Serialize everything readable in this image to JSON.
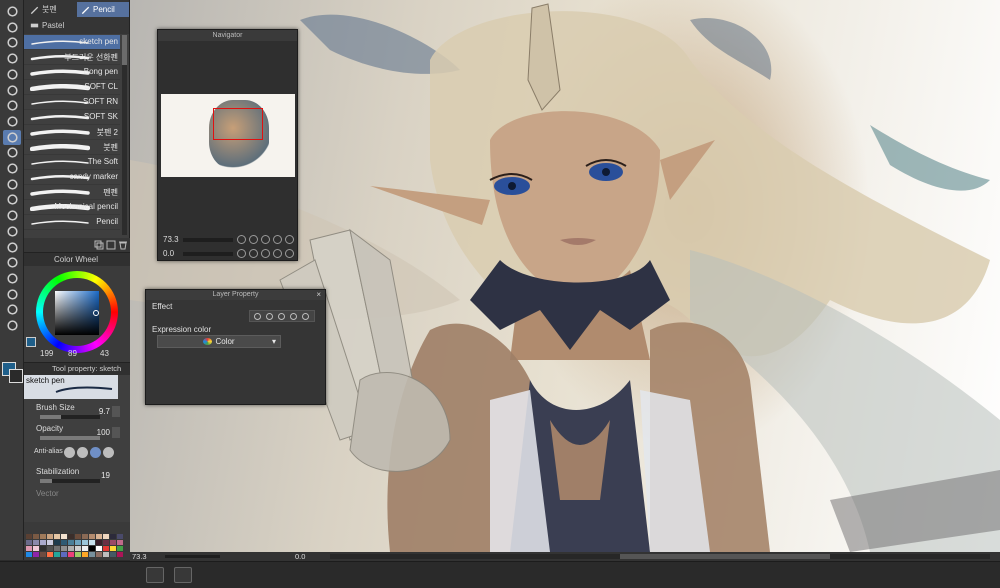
{
  "tools": {
    "items": [
      "hand-icon",
      "zoom-icon",
      "move-icon",
      "lasso-icon",
      "magic-wand-icon",
      "eyedropper-icon",
      "pen-icon",
      "pencil-icon",
      "brush-icon",
      "airbrush-icon",
      "decoration-icon",
      "eraser-icon",
      "blend-icon",
      "fill-icon",
      "gradient-icon",
      "figure-icon",
      "frame-icon",
      "ruler-icon",
      "text-icon",
      "balloon-icon",
      "correct-line-icon"
    ],
    "active_index": 8,
    "colors": {
      "main": "#1f5f8a",
      "sub": "#2a2a2a"
    }
  },
  "brush_panel": {
    "tabs": [
      {
        "label": "붓펜",
        "active": false
      },
      {
        "label": "Pencil",
        "active": true
      },
      {
        "label": "Pastel",
        "active": false
      }
    ],
    "brushes": [
      {
        "name": "sketch pen",
        "active": true
      },
      {
        "name": "부드러운 선화펜",
        "active": false
      },
      {
        "name": "Bong pen",
        "active": false
      },
      {
        "name": "SOFT CL",
        "active": false
      },
      {
        "name": "SOFT RN",
        "active": false
      },
      {
        "name": "SOFT SK",
        "active": false
      },
      {
        "name": "붓펜 2",
        "active": false
      },
      {
        "name": "붓펜",
        "active": false
      },
      {
        "name": "The Soft",
        "active": false
      },
      {
        "name": "candy marker",
        "active": false
      },
      {
        "name": "펜펜",
        "active": false
      },
      {
        "name": "Mechanical pencil",
        "active": false
      },
      {
        "name": "Pencil",
        "active": false
      }
    ]
  },
  "color_panel": {
    "title": "Color Wheel",
    "h": "199",
    "s": "89",
    "v": "43",
    "accent": "#1a6ac8"
  },
  "tool_property": {
    "title": "Tool property: sketch pen",
    "brush_name": "sketch pen",
    "brush_size": {
      "label": "Brush Size",
      "value": "9.7",
      "fill": 0.35
    },
    "opacity": {
      "label": "Opacity",
      "value": "100",
      "fill": 1.0
    },
    "anti_alias": {
      "label": "Anti-alias",
      "selected": 2
    },
    "stabilization": {
      "label": "Stabilization",
      "value": "19",
      "fill": 0.2
    },
    "vector": {
      "label": "Vector"
    }
  },
  "swatches": [
    "#5a4033",
    "#7a5a44",
    "#a07a5a",
    "#c9a27f",
    "#e5c6a4",
    "#f3e2cf",
    "#3b2e2a",
    "#6b4c3b",
    "#8a6a55",
    "#b38b6e",
    "#d9b393",
    "#efd7bf",
    "#2c2a3a",
    "#4a4a6a",
    "#6a6a8a",
    "#8a8aaa",
    "#aaaacc",
    "#cccce0",
    "#1f3b4d",
    "#2f5a73",
    "#4a7f99",
    "#6ea4bf",
    "#9cc6d9",
    "#c9e2ee",
    "#3a1f2a",
    "#6a2f44",
    "#9a4a66",
    "#c06a8a",
    "#dd99b0",
    "#f0cbd7",
    "#303030",
    "#505050",
    "#707070",
    "#909090",
    "#b0b0b0",
    "#d0d0d0",
    "#f0f0f0",
    "#000000",
    "#ffffff",
    "#e53935",
    "#fdd835",
    "#43a047",
    "#1e88e5",
    "#8e24aa",
    "#6d4c41",
    "#ff7043",
    "#26a69a",
    "#5c6bc0",
    "#ec407a",
    "#9ccc65",
    "#ffa726",
    "#78909c",
    "#8d6e63",
    "#bdbdbd",
    "#455a64",
    "#ad1457"
  ],
  "navigator": {
    "title": "Navigator",
    "zoom": "73.3",
    "angle": "0.0"
  },
  "layer_property": {
    "title": "Layer Property",
    "effect_label": "Effect",
    "expression_label": "Expression color",
    "expression_value": "Color"
  },
  "status": {
    "zoom": "73.3",
    "angle": "0.0"
  }
}
